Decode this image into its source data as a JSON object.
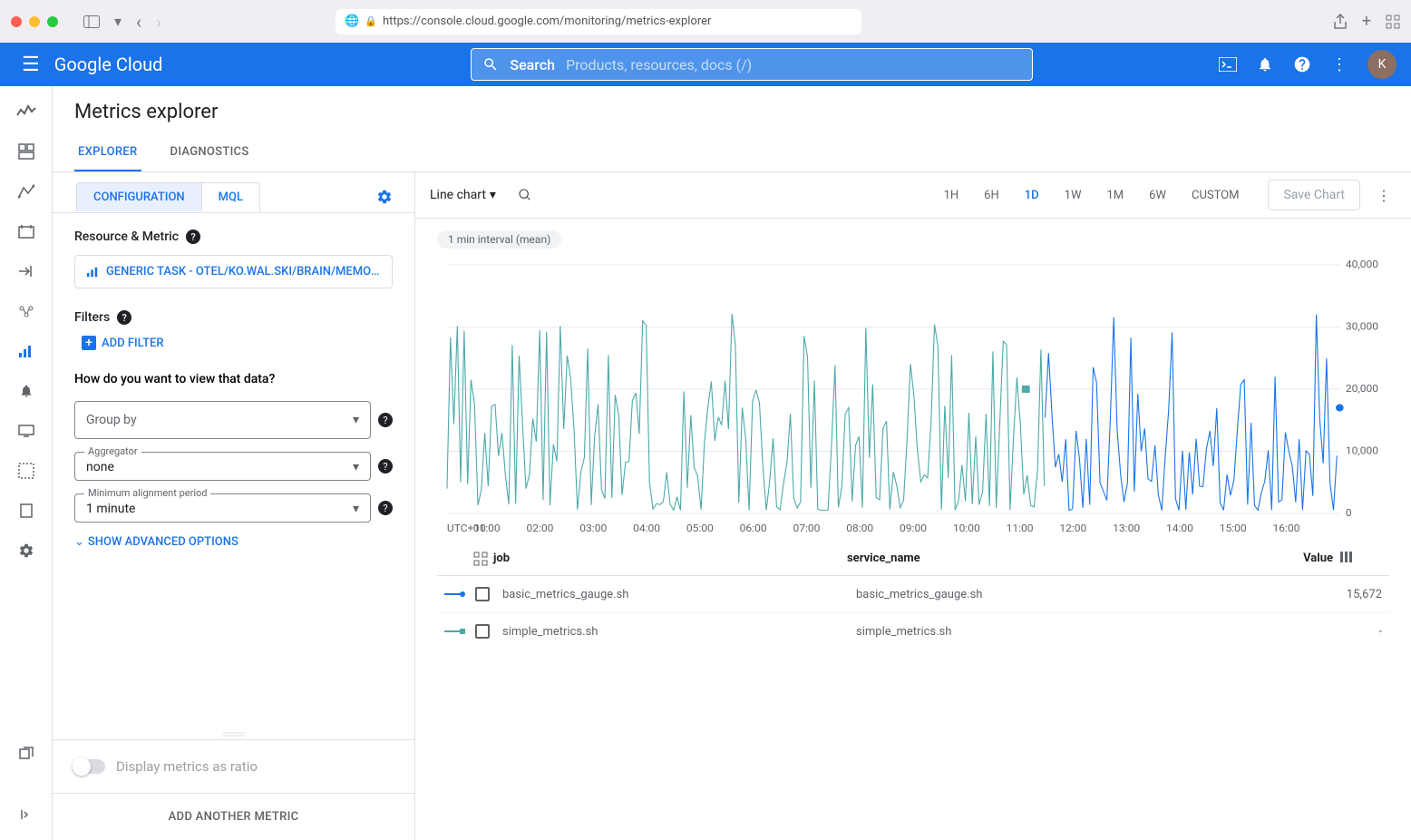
{
  "browser": {
    "url": "https://console.cloud.google.com/monitoring/metrics-explorer"
  },
  "header": {
    "logo": "Google Cloud",
    "search_label": "Search",
    "search_placeholder": "Products, resources, docs (/)",
    "avatar_letter": "K"
  },
  "page_title": "Metrics explorer",
  "tabs": {
    "explorer": "EXPLORER",
    "diagnostics": "DIAGNOSTICS"
  },
  "subtabs": {
    "configuration": "CONFIGURATION",
    "mql": "MQL"
  },
  "config": {
    "resource_metric_label": "Resource & Metric",
    "resource_chip": "GENERIC TASK - OTEL/KO.WAL.SKI/BRAIN/MEMORY/USE...",
    "filters_label": "Filters",
    "add_filter": "ADD FILTER",
    "view_question": "How do you want to view that data?",
    "group_by": "Group by",
    "aggregator_label": "Aggregator",
    "aggregator_value": "none",
    "alignment_label": "Minimum alignment period",
    "alignment_value": "1 minute",
    "show_advanced": "SHOW ADVANCED OPTIONS",
    "ratio_label": "Display metrics as ratio",
    "add_another": "ADD ANOTHER METRIC"
  },
  "chart_toolbar": {
    "chart_type": "Line chart",
    "time_ranges": [
      "1H",
      "6H",
      "1D",
      "1W",
      "1M",
      "6W",
      "CUSTOM"
    ],
    "active_range": "1D",
    "save": "Save Chart"
  },
  "interval_pill": "1 min interval (mean)",
  "chart_data": {
    "type": "line",
    "xlabel": "UTC+10",
    "x_ticks": [
      "01:00",
      "02:00",
      "03:00",
      "04:00",
      "05:00",
      "06:00",
      "07:00",
      "08:00",
      "09:00",
      "10:00",
      "11:00",
      "12:00",
      "13:00",
      "14:00",
      "15:00",
      "16:00"
    ],
    "y_ticks": [
      0,
      10000,
      20000,
      30000,
      40000
    ],
    "ylim": [
      0,
      40000
    ],
    "series": [
      {
        "name": "simple_metrics.sh",
        "color": "#4ba9a7",
        "span": [
          0.0,
          0.67
        ]
      },
      {
        "name": "basic_metrics_gauge.sh",
        "color": "#1a73e8",
        "span": [
          0.67,
          1.0
        ],
        "last_value": 15672
      }
    ]
  },
  "legend": {
    "col_job": "job",
    "col_service": "service_name",
    "col_value": "Value",
    "rows": [
      {
        "job": "basic_metrics_gauge.sh",
        "service": "basic_metrics_gauge.sh",
        "value": "15,672",
        "color": "#1a73e8",
        "shape": "dot"
      },
      {
        "job": "simple_metrics.sh",
        "service": "simple_metrics.sh",
        "value": "-",
        "color": "#4ba9a7",
        "shape": "sq"
      }
    ]
  }
}
